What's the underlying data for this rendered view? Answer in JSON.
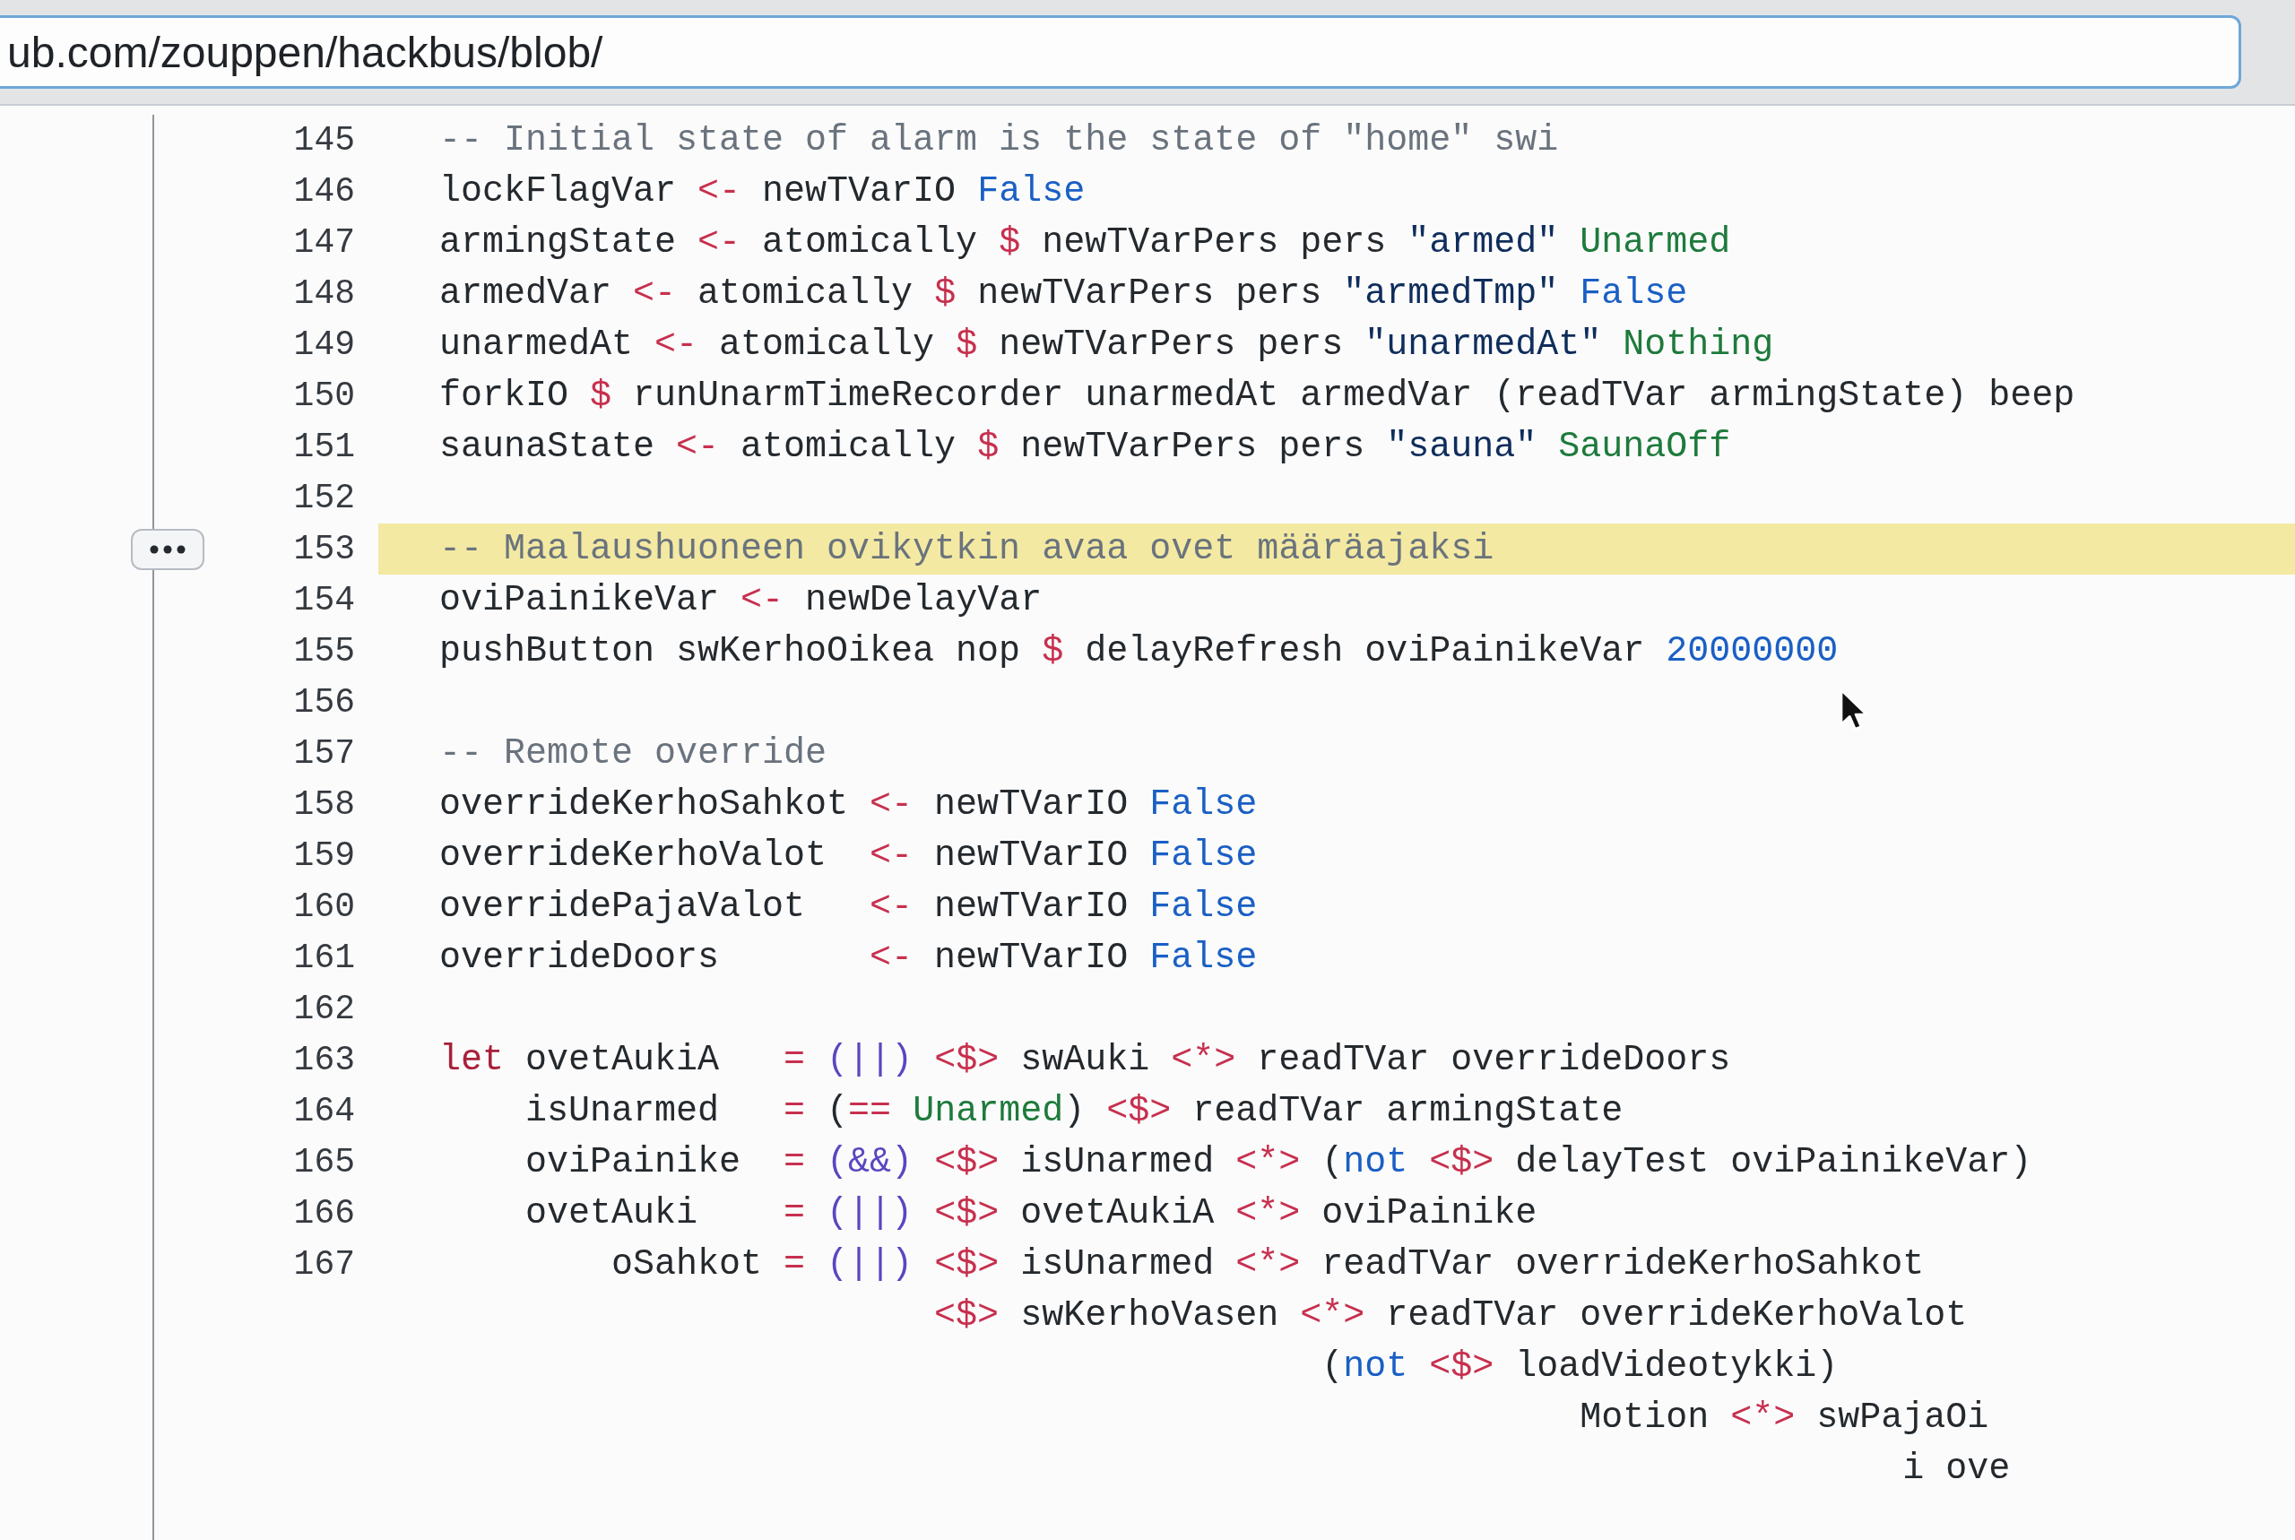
{
  "browser": {
    "url": "ub.com/zouppen/hackbus/blob/"
  },
  "code": {
    "lines": [
      {
        "number": "145",
        "selected": false,
        "tokens": [
          {
            "kind": "comment",
            "text": "  -- Initial state of alarm is the state of \"home\" swi"
          }
        ]
      },
      {
        "number": "146",
        "selected": false,
        "tokens": [
          {
            "kind": "plain",
            "text": "  lockFlagVar "
          },
          {
            "kind": "operator",
            "text": "<-"
          },
          {
            "kind": "plain",
            "text": " newTVarIO "
          },
          {
            "kind": "constant",
            "text": "False"
          }
        ]
      },
      {
        "number": "147",
        "selected": false,
        "tokens": [
          {
            "kind": "plain",
            "text": "  armingState "
          },
          {
            "kind": "operator",
            "text": "<-"
          },
          {
            "kind": "plain",
            "text": " atomically "
          },
          {
            "kind": "operator",
            "text": "$"
          },
          {
            "kind": "plain",
            "text": " newTVarPers pers "
          },
          {
            "kind": "string",
            "text": "\"armed\" "
          },
          {
            "kind": "constructor",
            "text": "Unarmed"
          }
        ]
      },
      {
        "number": "148",
        "selected": false,
        "tokens": [
          {
            "kind": "plain",
            "text": "  armedVar "
          },
          {
            "kind": "operator",
            "text": "<-"
          },
          {
            "kind": "plain",
            "text": " atomically "
          },
          {
            "kind": "operator",
            "text": "$"
          },
          {
            "kind": "plain",
            "text": " newTVarPers pers "
          },
          {
            "kind": "string",
            "text": "\"armedTmp\" "
          },
          {
            "kind": "constant",
            "text": "False"
          }
        ]
      },
      {
        "number": "149",
        "selected": false,
        "tokens": [
          {
            "kind": "plain",
            "text": "  unarmedAt "
          },
          {
            "kind": "operator",
            "text": "<-"
          },
          {
            "kind": "plain",
            "text": " atomically "
          },
          {
            "kind": "operator",
            "text": "$"
          },
          {
            "kind": "plain",
            "text": " newTVarPers pers "
          },
          {
            "kind": "string",
            "text": "\"unarmedAt\" "
          },
          {
            "kind": "constructor",
            "text": "Nothing"
          }
        ]
      },
      {
        "number": "150",
        "selected": false,
        "tokens": [
          {
            "kind": "plain",
            "text": "  forkIO "
          },
          {
            "kind": "operator",
            "text": "$"
          },
          {
            "kind": "plain",
            "text": " runUnarmTimeRecorder unarmedAt armedVar (readTVar armingState) beep"
          }
        ]
      },
      {
        "number": "151",
        "selected": false,
        "tokens": [
          {
            "kind": "plain",
            "text": "  saunaState "
          },
          {
            "kind": "operator",
            "text": "<-"
          },
          {
            "kind": "plain",
            "text": " atomically "
          },
          {
            "kind": "operator",
            "text": "$"
          },
          {
            "kind": "plain",
            "text": " newTVarPers pers "
          },
          {
            "kind": "string",
            "text": "\"sauna\" "
          },
          {
            "kind": "constructor",
            "text": "SaunaOff"
          }
        ]
      },
      {
        "number": "152",
        "selected": false
      },
      {
        "number": "153",
        "selected": true,
        "tokens": [
          {
            "kind": "comment",
            "text": "  -- Maalaushuoneen ovikytkin avaa ovet määräajaksi"
          }
        ]
      },
      {
        "number": "154",
        "selected": false,
        "tokens": [
          {
            "kind": "plain",
            "text": "  oviPainikeVar "
          },
          {
            "kind": "operator",
            "text": "<-"
          },
          {
            "kind": "plain",
            "text": " newDelayVar"
          }
        ]
      },
      {
        "number": "155",
        "selected": false,
        "tokens": [
          {
            "kind": "plain",
            "text": "  pushButton swKerhoOikea nop "
          },
          {
            "kind": "operator",
            "text": "$"
          },
          {
            "kind": "plain",
            "text": " delayRefresh oviPainikeVar "
          },
          {
            "kind": "number",
            "text": "20000000"
          }
        ]
      },
      {
        "number": "156",
        "selected": false
      },
      {
        "number": "157",
        "selected": false,
        "tokens": [
          {
            "kind": "comment",
            "text": "  -- Remote override"
          }
        ]
      },
      {
        "number": "158",
        "selected": false,
        "tokens": [
          {
            "kind": "plain",
            "text": "  overrideKerhoSahkot "
          },
          {
            "kind": "operator",
            "text": "<-"
          },
          {
            "kind": "plain",
            "text": " newTVarIO "
          },
          {
            "kind": "constant",
            "text": "False"
          }
        ]
      },
      {
        "number": "159",
        "selected": false,
        "tokens": [
          {
            "kind": "plain",
            "text": "  overrideKerhoValot  "
          },
          {
            "kind": "operator",
            "text": "<-"
          },
          {
            "kind": "plain",
            "text": " newTVarIO "
          },
          {
            "kind": "constant",
            "text": "False"
          }
        ]
      },
      {
        "number": "160",
        "selected": false,
        "tokens": [
          {
            "kind": "plain",
            "text": "  overridePajaValot   "
          },
          {
            "kind": "operator",
            "text": "<-"
          },
          {
            "kind": "plain",
            "text": " newTVarIO "
          },
          {
            "kind": "constant",
            "text": "False"
          }
        ]
      },
      {
        "number": "161",
        "selected": false,
        "tokens": [
          {
            "kind": "plain",
            "text": "  overrideDoors       "
          },
          {
            "kind": "operator",
            "text": "<-"
          },
          {
            "kind": "plain",
            "text": " newTVarIO "
          },
          {
            "kind": "constant",
            "text": "False"
          }
        ]
      },
      {
        "number": "162",
        "selected": false
      },
      {
        "number": "163",
        "selected": false,
        "tokens": [
          {
            "kind": "keyword",
            "text": "  let"
          },
          {
            "kind": "plain",
            "text": " ovetAukiA   "
          },
          {
            "kind": "operator",
            "text": "= "
          },
          {
            "kind": "function",
            "text": "(||) "
          },
          {
            "kind": "operator",
            "text": "<$>"
          },
          {
            "kind": "plain",
            "text": " swAuki "
          },
          {
            "kind": "operator",
            "text": "<*>"
          },
          {
            "kind": "plain",
            "text": " readTVar overrideDoors"
          }
        ]
      },
      {
        "number": "164",
        "selected": false,
        "tokens": [
          {
            "kind": "plain",
            "text": "      isUnarmed   "
          },
          {
            "kind": "operator",
            "text": "= "
          },
          {
            "kind": "plain",
            "text": "("
          },
          {
            "kind": "operator",
            "text": "== "
          },
          {
            "kind": "constructor",
            "text": "Unarmed"
          },
          {
            "kind": "plain",
            "text": ") "
          },
          {
            "kind": "operator",
            "text": "<$>"
          },
          {
            "kind": "plain",
            "text": " readTVar armingState"
          }
        ]
      },
      {
        "number": "165",
        "selected": false,
        "tokens": [
          {
            "kind": "plain",
            "text": "      oviPainike  "
          },
          {
            "kind": "operator",
            "text": "= "
          },
          {
            "kind": "function",
            "text": "(&&) "
          },
          {
            "kind": "operator",
            "text": "<$>"
          },
          {
            "kind": "plain",
            "text": " isUnarmed "
          },
          {
            "kind": "operator",
            "text": "<*>"
          },
          {
            "kind": "plain",
            "text": " ("
          },
          {
            "kind": "builtin",
            "text": "not "
          },
          {
            "kind": "operator",
            "text": "<$>"
          },
          {
            "kind": "plain",
            "text": " delayTest oviPainikeVar)"
          }
        ]
      },
      {
        "number": "166",
        "selected": false,
        "tokens": [
          {
            "kind": "plain",
            "text": "      ovetAuki    "
          },
          {
            "kind": "operator",
            "text": "= "
          },
          {
            "kind": "function",
            "text": "(||) "
          },
          {
            "kind": "operator",
            "text": "<$>"
          },
          {
            "kind": "plain",
            "text": " ovetAukiA "
          },
          {
            "kind": "operator",
            "text": "<*>"
          },
          {
            "kind": "plain",
            "text": " oviPainike"
          }
        ]
      },
      {
        "number": "167",
        "selected": false,
        "tokens": [
          {
            "kind": "plain",
            "text": "          oSahkot "
          },
          {
            "kind": "operator",
            "text": "= "
          },
          {
            "kind": "function",
            "text": "(||) "
          },
          {
            "kind": "operator",
            "text": "<$>"
          },
          {
            "kind": "plain",
            "text": " isUnarmed "
          },
          {
            "kind": "operator",
            "text": "<*>"
          },
          {
            "kind": "plain",
            "text": " readTVar overrideKerhoSahkot"
          }
        ]
      },
      {
        "selected": false,
        "tokens": [
          {
            "kind": "operator",
            "text": "                         <$>"
          },
          {
            "kind": "plain",
            "text": " swKerhoVasen "
          },
          {
            "kind": "operator",
            "text": "<*>"
          },
          {
            "kind": "plain",
            "text": " readTVar overrideKerhoValot"
          }
        ]
      },
      {
        "selected": false,
        "tokens": [
          {
            "kind": "plain",
            "text": "                                           ("
          },
          {
            "kind": "builtin",
            "text": "not "
          },
          {
            "kind": "operator",
            "text": "<$>"
          },
          {
            "kind": "plain",
            "text": " loadVideotykki)"
          }
        ]
      },
      {
        "selected": false,
        "tokens": [
          {
            "kind": "plain",
            "text": "                                                       Motion "
          },
          {
            "kind": "operator",
            "text": "<*>"
          },
          {
            "kind": "plain",
            "text": " swPajaOi"
          }
        ]
      },
      {
        "selected": false,
        "tokens": [
          {
            "kind": "plain",
            "text": "                                                                      i ove"
          }
        ]
      }
    ]
  }
}
